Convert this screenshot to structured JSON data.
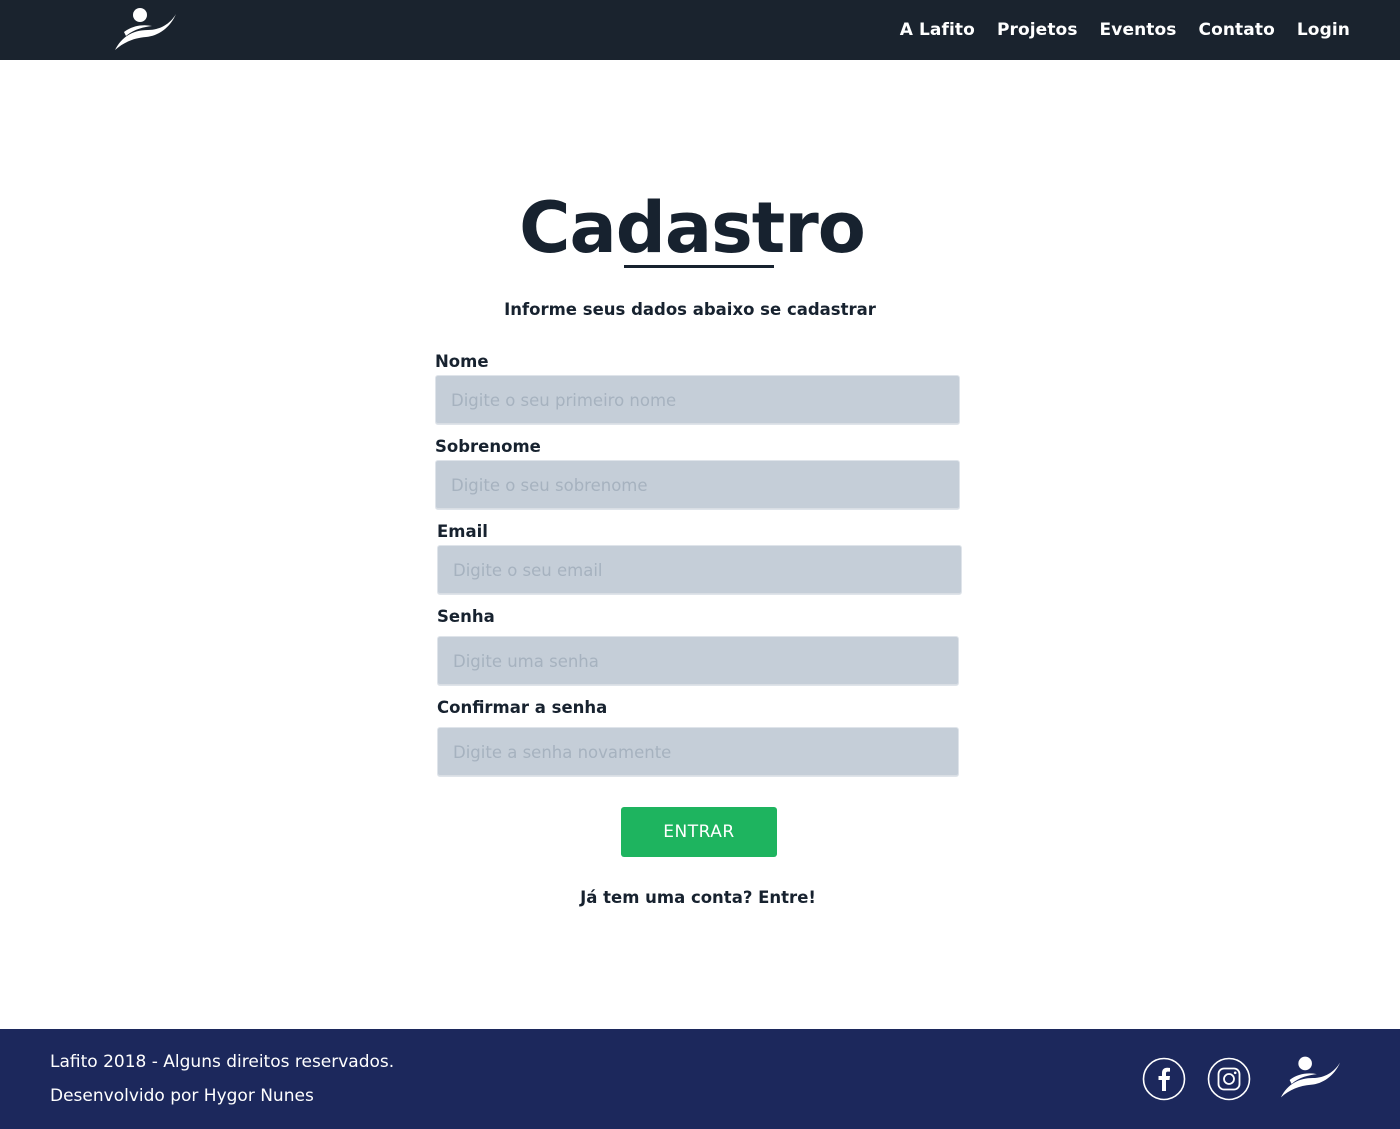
{
  "nav": {
    "logo_icon": "lafito-logo-icon",
    "links": [
      "A Lafito",
      "Projetos",
      "Eventos",
      "Contato",
      "Login"
    ]
  },
  "form": {
    "title": "Cadastro",
    "subtitle": "Informe seus dados abaixo se cadastrar",
    "fields": [
      {
        "label": "Nome",
        "placeholder": "Digite o seu primeiro nome",
        "value": ""
      },
      {
        "label": "Sobrenome",
        "placeholder": "Digite o seu sobrenome",
        "value": ""
      },
      {
        "label": "Email",
        "placeholder": "Digite o seu email",
        "value": ""
      },
      {
        "label": "Senha",
        "placeholder": "Digite uma senha",
        "value": ""
      },
      {
        "label": "Confirmar a senha",
        "placeholder": "Digite a senha novamente",
        "value": ""
      }
    ],
    "submit_label": "ENTRAR",
    "login_link": "Já tem uma conta? Entre!"
  },
  "footer": {
    "copyright": "Lafito 2018 - Alguns direitos reservados.",
    "credit": "Desenvolvido por Hygor Nunes",
    "social_icons": [
      "facebook-icon",
      "instagram-icon"
    ],
    "logo_icon": "lafito-logo-icon"
  },
  "colors": {
    "navbar": "#1a232e",
    "footer": "#1c285c",
    "button": "#1eb45f",
    "input_bg": "#c5ced8",
    "text": "#17222f"
  }
}
